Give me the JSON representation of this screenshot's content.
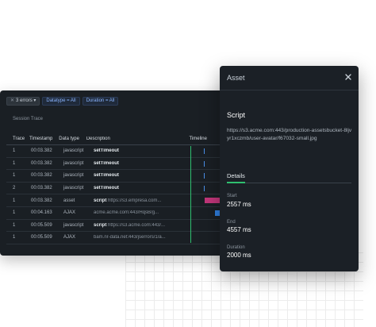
{
  "filters": {
    "errors_chip": "3 errors",
    "datatype_chip": "Datatype = All",
    "duration_chip": "Duration = All"
  },
  "session": {
    "title": "Session Trace"
  },
  "table": {
    "headers": [
      "Trace",
      "Timestamp",
      "Data type",
      "Description",
      "Timeline"
    ],
    "rows": [
      {
        "trace": "1",
        "timestamp": "00:03.382",
        "type": "javascript",
        "bold": "setTimeout",
        "url": ""
      },
      {
        "trace": "1",
        "timestamp": "00:03.382",
        "type": "javascript",
        "bold": "setTimeout",
        "url": ""
      },
      {
        "trace": "1",
        "timestamp": "00:03.382",
        "type": "javascript",
        "bold": "setTimeout",
        "url": ""
      },
      {
        "trace": "2",
        "timestamp": "00:03.382",
        "type": "javascript",
        "bold": "setTimeout",
        "url": ""
      },
      {
        "trace": "1",
        "timestamp": "00:03.382",
        "type": "asset",
        "bold": "script",
        "url": "https://s3.empresa.com..."
      },
      {
        "trace": "1",
        "timestamp": "00:04.163",
        "type": "AJAX",
        "bold": "",
        "url": "acme.acme.com:443/HqsB/g..."
      },
      {
        "trace": "1",
        "timestamp": "00:05.509",
        "type": "javascript",
        "bold": "script",
        "url": "https://s3.acme.com:443/..."
      },
      {
        "trace": "1",
        "timestamp": "00:05.509",
        "type": "AJAX",
        "bold": "",
        "url": "bam.nr-data.net:443/jserrors/1/a..."
      }
    ]
  },
  "asset_panel": {
    "title": "Asset",
    "asset_type": "Script",
    "url": "https://s3.acme.com:443/production-assetsbucket-8ljvyr1xczmb/user-avatar/f67032-small.jpg",
    "tab_label": "Details",
    "start_label": "Start",
    "start_value": "2557 ms",
    "end_label": "End",
    "end_value": "4557 ms",
    "duration_label": "Duration",
    "duration_value": "2000 ms"
  },
  "colors": {
    "marker_line": "#2fbf6f",
    "tick_blue": "#4a8fe7",
    "asset_bar": "#c2367a",
    "ajax_bar": "#2f7fe0"
  }
}
